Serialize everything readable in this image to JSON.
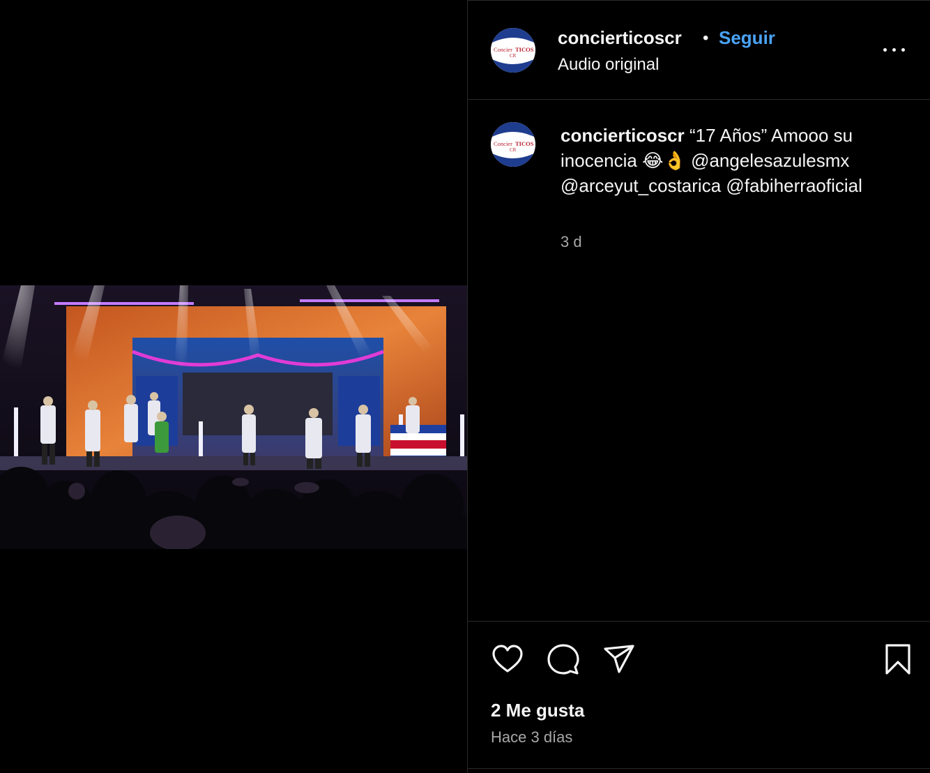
{
  "post": {
    "username": "concierticoscr",
    "separator": "•",
    "follow_label": "Seguir",
    "audio_label": "Audio original",
    "more_icon": "more-options-icon"
  },
  "avatar": {
    "line1": "Concier",
    "line2": "TICOS",
    "line3": "CR"
  },
  "caption": {
    "username": "concierticoscr",
    "text_before": "“17 Años” Amooo su inocencia 😂👌",
    "mentions": [
      "@angelesazulesmx",
      "@arceyut_costarica",
      "@fabiherraoficial"
    ],
    "time": "3 d"
  },
  "actions": {
    "like_icon": "heart-icon",
    "comment_icon": "comment-icon",
    "share_icon": "paper-plane-icon",
    "save_icon": "bookmark-icon"
  },
  "stats": {
    "likes": "2 Me gusta",
    "posted": "Hace 3 días"
  },
  "colors": {
    "background": "#000000",
    "text": "#f5f5f5",
    "secondary_text": "#a8a8a8",
    "link": "#4aa3f7",
    "divider": "#2a2a2a"
  }
}
